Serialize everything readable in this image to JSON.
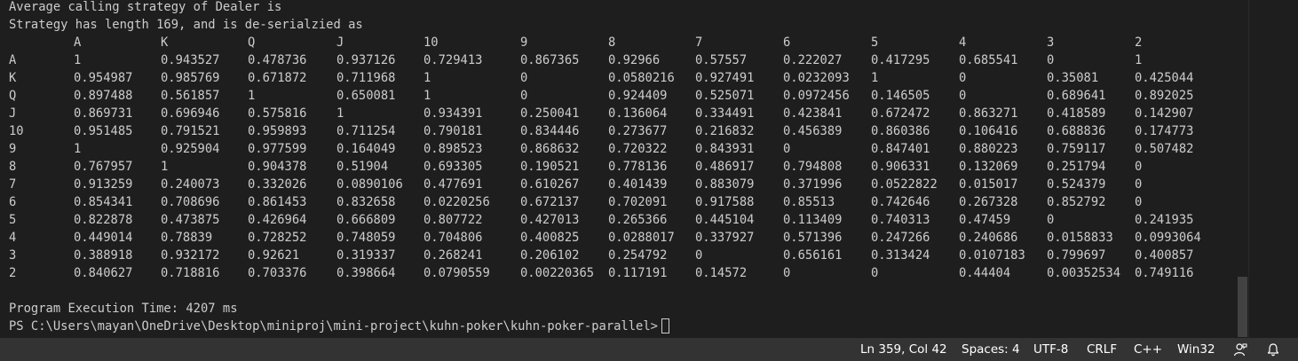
{
  "terminal": {
    "heading_line1": "Average calling strategy of Dealer is",
    "heading_line2": "Strategy has length 169, and is de-serialzied as",
    "columns": [
      "",
      "A",
      "K",
      "Q",
      "J",
      "10",
      "9",
      "8",
      "7",
      "6",
      "5",
      "4",
      "3",
      "2"
    ],
    "rows": [
      [
        "A",
        "1",
        "0.943527",
        "0.478736",
        "0.937126",
        "0.729413",
        "0.867365",
        "0.92966",
        "0.57557",
        "0.222027",
        "0.417295",
        "0.685541",
        "0",
        "1"
      ],
      [
        "K",
        "0.954987",
        "0.985769",
        "0.671872",
        "0.711968",
        "1",
        "0",
        "0.0580216",
        "0.927491",
        "0.0232093",
        "1",
        "0",
        "0.35081",
        "0.425044"
      ],
      [
        "Q",
        "0.897488",
        "0.561857",
        "1",
        "0.650081",
        "1",
        "0",
        "0.924409",
        "0.525071",
        "0.0972456",
        "0.146505",
        "0",
        "0.689641",
        "0.892025"
      ],
      [
        "J",
        "0.869731",
        "0.696946",
        "0.575816",
        "1",
        "0.934391",
        "0.250041",
        "0.136064",
        "0.334491",
        "0.423841",
        "0.672472",
        "0.863271",
        "0.418589",
        "0.142907"
      ],
      [
        "10",
        "0.951485",
        "0.791521",
        "0.959893",
        "0.711254",
        "0.790181",
        "0.834446",
        "0.273677",
        "0.216832",
        "0.456389",
        "0.860386",
        "0.106416",
        "0.688836",
        "0.174773"
      ],
      [
        "9",
        "1",
        "0.925904",
        "0.977599",
        "0.164049",
        "0.898523",
        "0.868632",
        "0.720322",
        "0.843931",
        "0",
        "0.847401",
        "0.880223",
        "0.759117",
        "0.507482"
      ],
      [
        "8",
        "0.767957",
        "1",
        "0.904378",
        "0.51904",
        "0.693305",
        "0.190521",
        "0.778136",
        "0.486917",
        "0.794808",
        "0.906331",
        "0.132069",
        "0.251794",
        "0"
      ],
      [
        "7",
        "0.913259",
        "0.240073",
        "0.332026",
        "0.0890106",
        "0.477691",
        "0.610267",
        "0.401439",
        "0.883079",
        "0.371996",
        "0.0522822",
        "0.015017",
        "0.524379",
        "0"
      ],
      [
        "6",
        "0.854341",
        "0.708696",
        "0.861453",
        "0.832658",
        "0.0220256",
        "0.672137",
        "0.702091",
        "0.917588",
        "0.85513",
        "0.742646",
        "0.267328",
        "0.852792",
        "0"
      ],
      [
        "5",
        "0.822878",
        "0.473875",
        "0.426964",
        "0.666809",
        "0.807722",
        "0.427013",
        "0.265366",
        "0.445104",
        "0.113409",
        "0.740313",
        "0.47459",
        "0",
        "0.241935"
      ],
      [
        "4",
        "0.449014",
        "0.78839",
        "0.728252",
        "0.748059",
        "0.704806",
        "0.400825",
        "0.0288017",
        "0.337927",
        "0.571396",
        "0.247266",
        "0.240686",
        "0.0158833",
        "0.0993064"
      ],
      [
        "3",
        "0.388918",
        "0.932172",
        "0.92621",
        "0.319337",
        "0.268241",
        "0.206102",
        "0.254792",
        "0",
        "0.656161",
        "0.313424",
        "0.0107183",
        "0.799697",
        "0.400857"
      ],
      [
        "2",
        "0.840627",
        "0.718816",
        "0.703376",
        "0.398664",
        "0.0790559",
        "0.00220365",
        "0.117191",
        "0.14572",
        "0",
        "0",
        "0.44404",
        "0.00352534",
        "0.749116"
      ]
    ],
    "execution_time": "Program Execution Time: 4207 ms",
    "prompt": "PS C:\\Users\\mayan\\OneDrive\\Desktop\\miniproj\\mini-project\\kuhn-poker\\kuhn-poker-parallel>"
  },
  "status_bar": {
    "cursor_position": "Ln 359, Col 42",
    "indentation": "Spaces: 4",
    "encoding": "UTF-8",
    "line_ending": "CRLF",
    "language": "C++",
    "platform": "Win32",
    "feedback_icon": "feedback-person-icon",
    "notification_icon": "bell-icon"
  },
  "colors": {
    "background": "#1e1e1e",
    "text": "#cccccc",
    "status_bar": "#333333",
    "status_text": "#ffffff",
    "scrollbar_thumb": "#424242"
  }
}
